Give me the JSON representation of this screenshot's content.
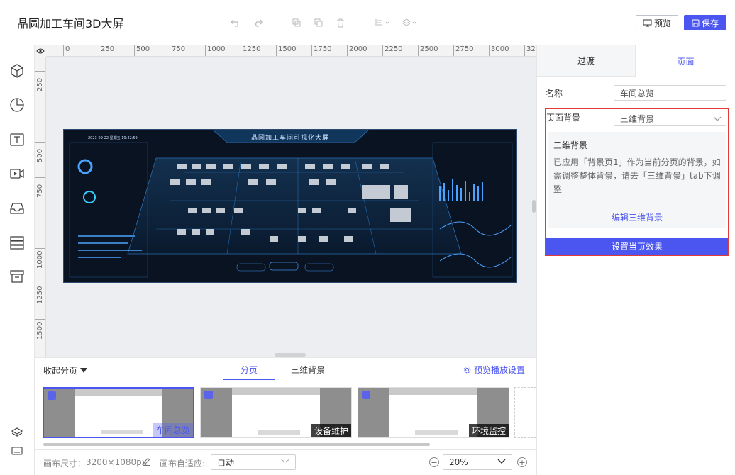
{
  "header": {
    "title": "晶圆加工车间3D大屏",
    "preview_label": "预览",
    "save_label": "保存"
  },
  "ruler": {
    "top_ticks": [
      "0",
      "250",
      "500",
      "750",
      "1000",
      "1250",
      "1500",
      "1750",
      "2000",
      "2250",
      "2500",
      "2750",
      "3000",
      "32"
    ],
    "left_ticks": [
      "250",
      "500",
      "750",
      "1000",
      "1250",
      "1500"
    ]
  },
  "dashboard_preview": {
    "title": "晶圆加工车间可视化大屏",
    "date": "2023-09-22  星期五  10:42:59"
  },
  "pages": {
    "collapse_label": "收起分页",
    "tabs": [
      "分页",
      "三维背景"
    ],
    "preview_settings_label": "预览播放设置",
    "items": [
      {
        "label": "车间总览",
        "selected": true
      },
      {
        "label": "设备维护",
        "selected": false
      },
      {
        "label": "环境监控",
        "selected": false
      }
    ]
  },
  "footer": {
    "canvas_size_label": "画布尺寸：",
    "canvas_size_value": "3200×1080px",
    "fit_label": "画布自适应:",
    "fit_value": "自动",
    "zoom_value": "20%"
  },
  "right_panel": {
    "tabs": [
      "过渡",
      "页面"
    ],
    "active_tab": "页面",
    "name_label": "名称",
    "name_value": "车间总览",
    "bg_label": "页面背景",
    "bg_value": "三维背景",
    "info_title": "三维背景",
    "info_text": "已应用「背景页1」作为当前分页的背景，如需调整整体背景，请去「三维背景」tab下调整",
    "edit_link": "编辑三维背景",
    "apply_label": "设置当页效果"
  },
  "colors": {
    "accent": "#4b55f0",
    "highlight_border": "#e53935"
  }
}
